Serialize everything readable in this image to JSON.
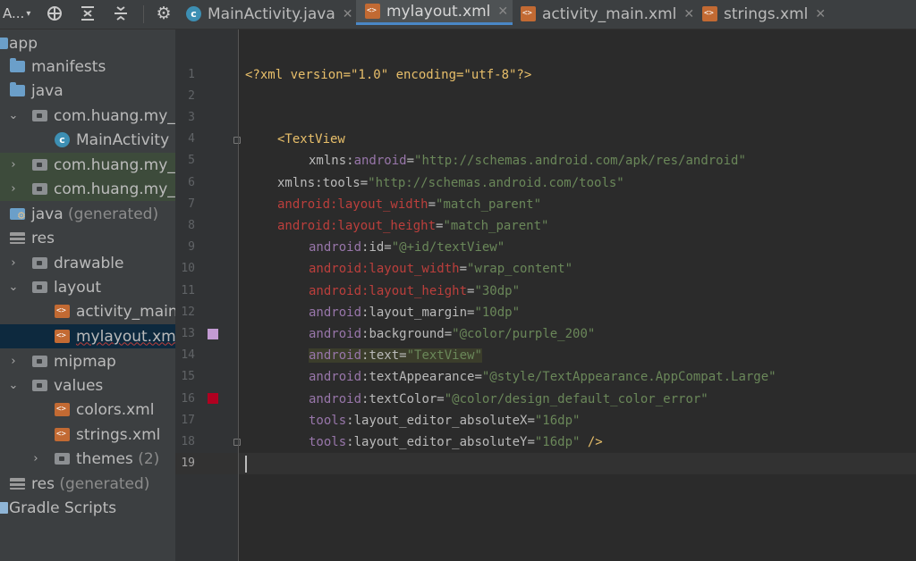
{
  "toolbar": {
    "project_selector": "A...",
    "caret": "▾",
    "icons": [
      "target-icon",
      "expand-icon",
      "collapse-icon",
      "gear-icon"
    ]
  },
  "tabs": [
    {
      "label": "MainActivity.java",
      "type": "java",
      "active": false
    },
    {
      "label": "mylayout.xml",
      "type": "xml",
      "active": true
    },
    {
      "label": "activity_main.xml",
      "type": "xml",
      "active": false
    },
    {
      "label": "strings.xml",
      "type": "xml",
      "active": false
    }
  ],
  "tree": {
    "app": "app",
    "manifests": "manifests",
    "java": "java",
    "pkg_main": "com.huang.my_s",
    "main_activity": "MainActivity",
    "pkg_test1": "com.huang.my_s",
    "pkg_test2": "com.huang.my_s",
    "java_gen": "java",
    "java_gen_suffix": "(generated)",
    "res": "res",
    "drawable": "drawable",
    "layout": "layout",
    "activity_main": "activity_main.",
    "mylayout": "mylayout.xml",
    "mipmap": "mipmap",
    "values": "values",
    "colors": "colors.xml",
    "strings": "strings.xml",
    "themes": "themes",
    "themes_count": "(2)",
    "res_gen": "res",
    "res_gen_suffix": "(generated)",
    "gradle": "Gradle Scripts"
  },
  "editor": {
    "line_numbers": [
      "1",
      "2",
      "3",
      "4",
      "5",
      "6",
      "7",
      "8",
      "9",
      "10",
      "11",
      "12",
      "13",
      "14",
      "15",
      "16",
      "17",
      "18",
      "19"
    ],
    "colors": {
      "purple_swatch": "#c39bd3",
      "error_swatch": "#b00020"
    },
    "lines": {
      "l1": "<?xml version=\"1.0\" encoding=\"utf-8\"?>",
      "l4_tag": "<TextView",
      "l5": {
        "a": "xmlns:",
        "b": "android",
        "c": "=",
        "v": "\"http://schemas.android.com/apk/res/android\""
      },
      "l6": {
        "a": "xmlns:tools=",
        "v": "\"http://schemas.android.com/tools\""
      },
      "l7": {
        "a": "android:layout_width",
        "c": "=",
        "v": "\"match_parent\""
      },
      "l8": {
        "a": "android:layout_height",
        "c": "=",
        "v": "\"match_parent\""
      },
      "l9": {
        "ns": "android",
        "a": ":id=",
        "v": "\"@+id/textView\""
      },
      "l10": {
        "a": "android:layout_width",
        "c": "=",
        "v": "\"wrap_content\""
      },
      "l11": {
        "a": "android:layout_height",
        "c": "=",
        "v": "\"30dp\""
      },
      "l12": {
        "ns": "android",
        "a": ":layout_margin=",
        "v": "\"10dp\""
      },
      "l13": {
        "ns": "android",
        "a": ":background=",
        "v": "\"@color/purple_200\""
      },
      "l14": {
        "ns": "android",
        "a": ":text=",
        "v": "\"TextView\""
      },
      "l15": {
        "ns": "android",
        "a": ":textAppearance=",
        "v": "\"@style/TextAppearance.AppCompat.Large\""
      },
      "l16": {
        "ns": "android",
        "a": ":textColor=",
        "v": "\"@color/design_default_color_error\""
      },
      "l17": {
        "ns": "tools",
        "a": ":layout_editor_absoluteX=",
        "v": "\"16dp\""
      },
      "l18": {
        "ns": "tools",
        "a": ":layout_editor_absoluteY=",
        "v": "\"16dp\"",
        "end": " />"
      }
    }
  }
}
